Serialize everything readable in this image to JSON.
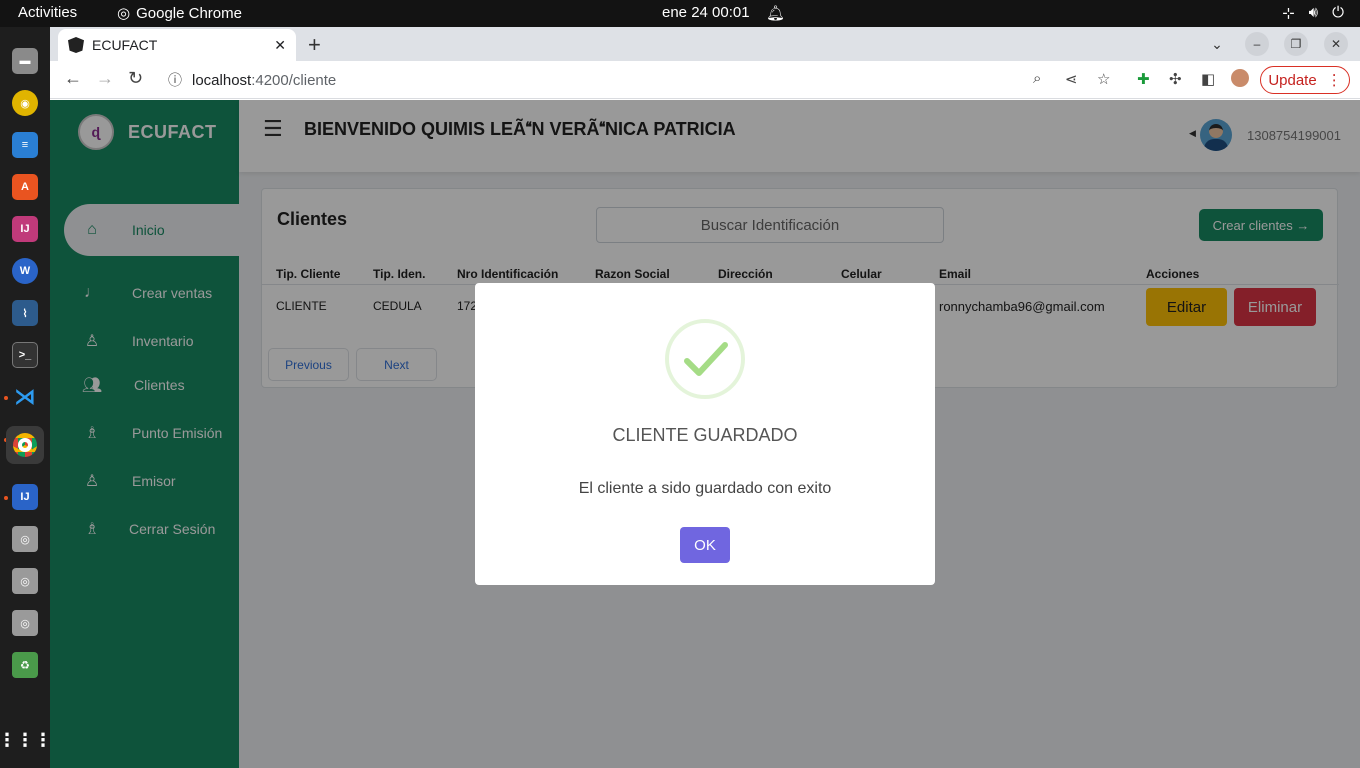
{
  "system": {
    "activities": "Activities",
    "app_name": "Google Chrome",
    "clock": "ene 24  00:01"
  },
  "dock": {
    "items": [
      "files-icon",
      "rhythmbox-icon",
      "writer-icon",
      "app-center-icon",
      "intellij-icon",
      "webstorm-icon",
      "mysql-workbench-icon",
      "terminal-icon",
      "vscode-icon",
      "chrome-icon",
      "intellij-alt-icon",
      "disk-icon",
      "disk-icon",
      "disk-icon",
      "trash-icon",
      "show-apps-icon"
    ]
  },
  "browser": {
    "tab_title": "ECUFACT",
    "url_host": "localhost",
    "url_rest": ":4200/cliente",
    "update_label": "Update"
  },
  "app": {
    "brand": "ECUFACT",
    "logo_text": "ɖ",
    "menu": [
      {
        "label": "Inicio",
        "icon": "home-icon"
      },
      {
        "label": "Crear ventas",
        "icon": "stethoscope-icon"
      },
      {
        "label": "Inventario",
        "icon": "user-icon"
      },
      {
        "label": "Clientes",
        "icon": "users-icon"
      },
      {
        "label": "Punto Emisión",
        "icon": "user-doctor-icon"
      },
      {
        "label": "Emisor",
        "icon": "user-icon"
      },
      {
        "label": "Cerrar Sesión",
        "icon": "user-doctor-icon"
      }
    ],
    "welcome": "BIENVENIDO QUIMIS LEÃN VERÃNICA PATRICIA",
    "user_id": "1308754199001"
  },
  "clients": {
    "title": "Clientes",
    "search_placeholder": "Buscar Identificación",
    "create_label": "Crear clientes →",
    "columns": [
      "Tip. Cliente",
      "Tip. Iden.",
      "Nro Identificación",
      "Razon Social",
      "Dirección",
      "Celular",
      "Email",
      "Acciones"
    ],
    "rows": [
      {
        "tipo_cliente": "CLIENTE",
        "tipo_iden": "CEDULA",
        "nro_identificacion": "172",
        "email": "ronnychamba96@gmail.com"
      }
    ],
    "edit_label": "Editar",
    "delete_label": "Eliminar",
    "prev_label": "Previous",
    "next_label": "Next"
  },
  "modal": {
    "title": "CLIENTE GUARDADO",
    "text": "El cliente a sido guardado con exito",
    "ok_label": "OK",
    "success_color": "#a5dc86"
  }
}
